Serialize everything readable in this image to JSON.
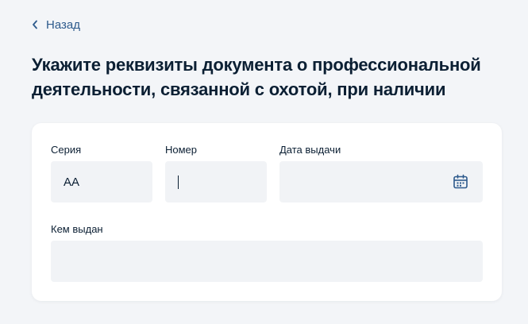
{
  "nav": {
    "back_label": "Назад"
  },
  "page": {
    "title": "Укажите реквизиты документа о профессиональной деятельности, связанной с охотой, при наличии"
  },
  "form": {
    "series": {
      "label": "Серия",
      "value": "АА"
    },
    "number": {
      "label": "Номер",
      "value": ""
    },
    "issue_date": {
      "label": "Дата выдачи",
      "value": "",
      "icon": "calendar-icon"
    },
    "issued_by": {
      "label": "Кем выдан",
      "value": ""
    }
  },
  "colors": {
    "background": "#f3f5f8",
    "card": "#ffffff",
    "field": "#f1f3f6",
    "text": "#0b1f33",
    "link": "#2d5a8c"
  }
}
